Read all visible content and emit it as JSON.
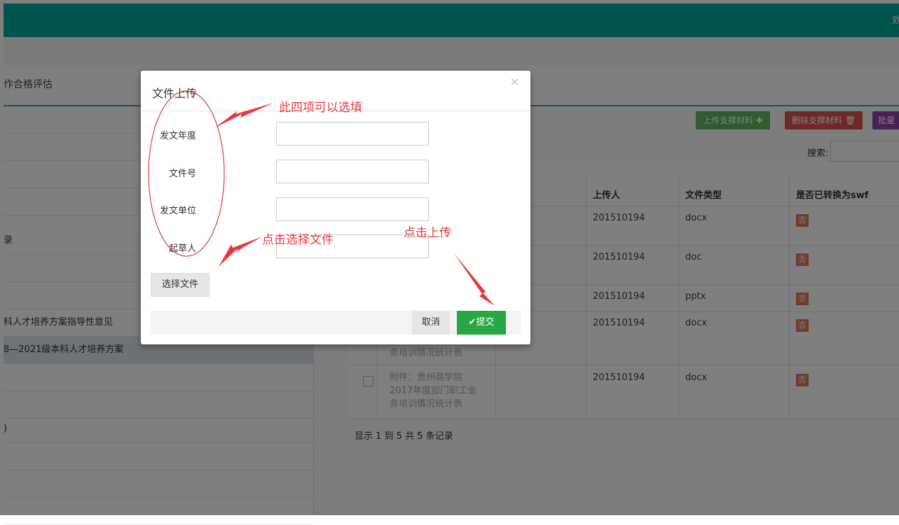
{
  "header": {
    "user_fragment": "欢"
  },
  "tab": {
    "label": "作合格评估"
  },
  "left_tree": {
    "rows": [
      "",
      "",
      "",
      "",
      "录",
      "",
      "",
      "科人才培养方案指导性意见",
      "8—2021级本科人才培养方案",
      "",
      "",
      ")",
      "",
      "",
      ""
    ]
  },
  "toolbar": {
    "upload_label": "上传支撑材料 ✚",
    "delete_label": "删除支撑材料 🗑",
    "batch_label": "批量",
    "search_label": "搜索:"
  },
  "table": {
    "headers": {
      "uploader": "上传人",
      "file_type": "文件类型",
      "swf": "是否已转换为swf"
    },
    "rows": [
      {
        "uploader": "201510194",
        "type": "docx",
        "swf": "否",
        "name": ""
      },
      {
        "uploader": "201510194",
        "type": "doc",
        "swf": "否",
        "name": ""
      },
      {
        "uploader": "201510194",
        "type": "pptx",
        "swf": "否",
        "name": ""
      },
      {
        "uploader": "201510194",
        "type": "docx",
        "swf": "否",
        "name": "务培训情况统计表"
      },
      {
        "uploader": "201510194",
        "type": "docx",
        "swf": "否",
        "name": "附件：贵州商学院\n2017年度部门职工业\n务培训情况统计表"
      }
    ],
    "footer": "显示 1 到 5 共 5 条记录"
  },
  "modal": {
    "title": "文件上传",
    "close": "×",
    "fields": {
      "year_label": "发文年度",
      "number_label": "文件号",
      "unit_label": "发文单位",
      "drafter_label": "起草人"
    },
    "choose_file": "选择文件",
    "cancel": "取消",
    "submit": "✔提交"
  },
  "annotations": {
    "optional_note": "此四项可以选填",
    "choose_note": "点击选择文件",
    "upload_note": "点击上传",
    "color": "#e8383d"
  }
}
